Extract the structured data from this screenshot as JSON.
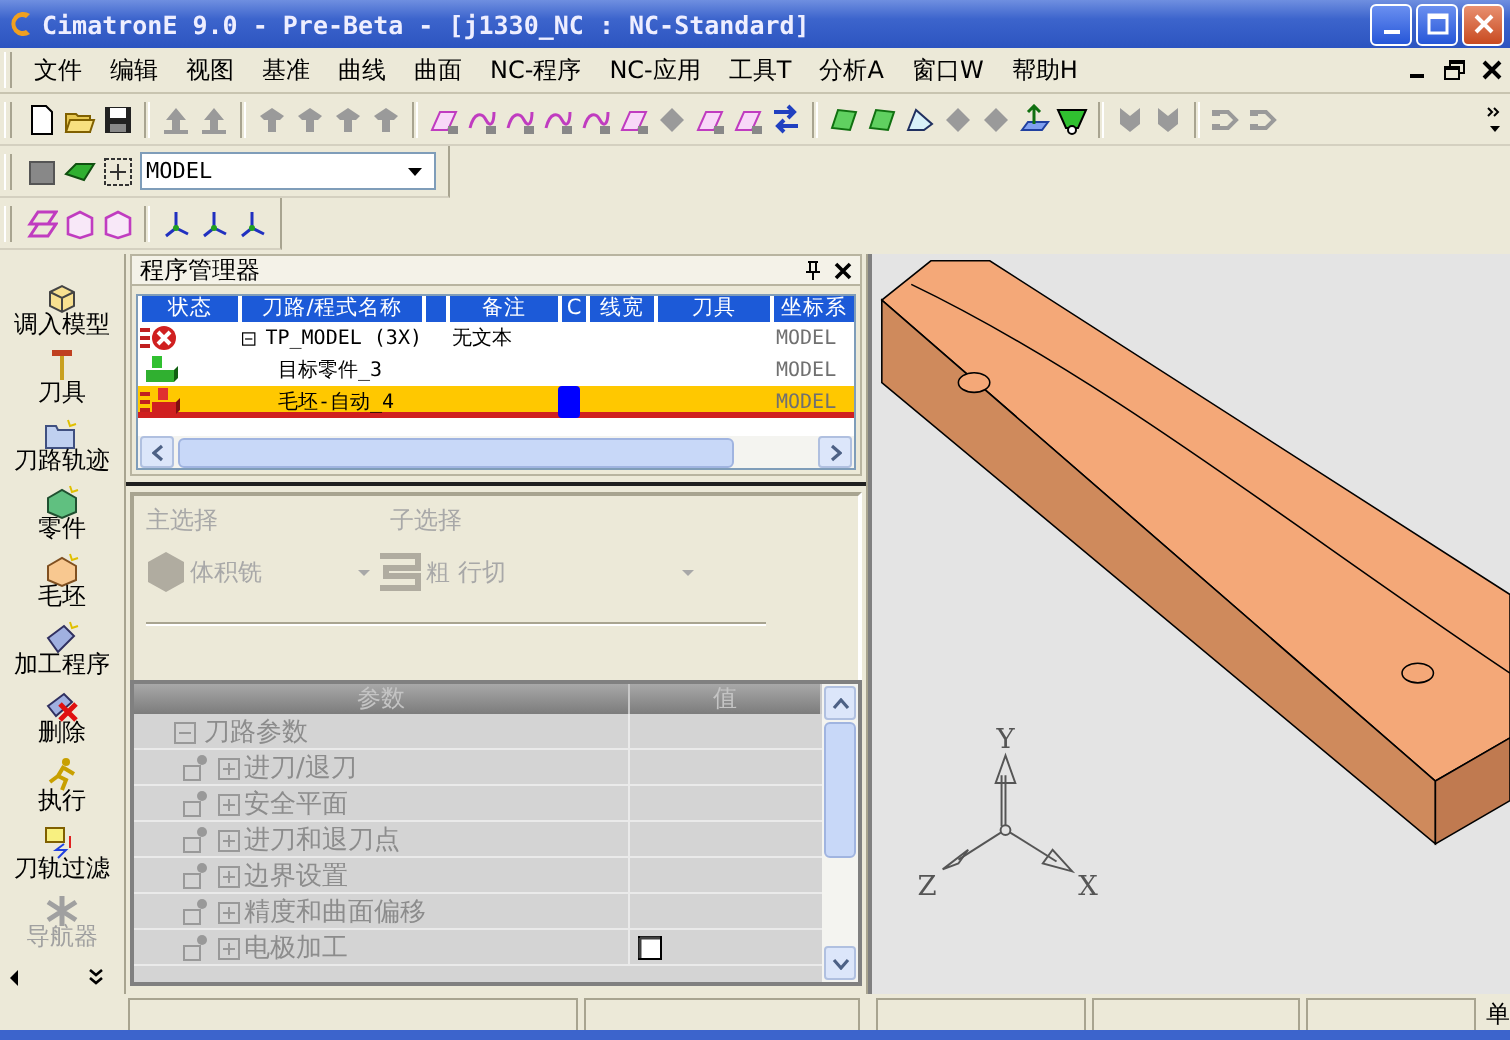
{
  "window": {
    "title": "CimatronE 9.0 - Pre-Beta - [j1330_NC : NC-Standard]"
  },
  "menu": [
    "文件",
    "编辑",
    "视图",
    "基准",
    "曲线",
    "曲面",
    "NC-程序",
    "NC-应用",
    "工具T",
    "分析A",
    "窗口W",
    "帮助H"
  ],
  "toolbar": {
    "coordinate_system": "MODEL"
  },
  "sidebar": {
    "items": [
      {
        "label": "调入模型",
        "disabled": false
      },
      {
        "label": "刀具",
        "disabled": false
      },
      {
        "label": "刀路轨迹",
        "disabled": false
      },
      {
        "label": "零件",
        "disabled": false
      },
      {
        "label": "毛坯",
        "disabled": false
      },
      {
        "label": "加工程序",
        "disabled": false
      },
      {
        "label": "删除",
        "disabled": false
      },
      {
        "label": "执行",
        "disabled": false
      },
      {
        "label": "刀轨过滤",
        "disabled": false
      },
      {
        "label": "导航器",
        "disabled": true
      }
    ]
  },
  "program_manager": {
    "title": "程序管理器",
    "columns": [
      "状态",
      "刀路/程式名称",
      "",
      "备注",
      "C",
      "线宽",
      "刀具",
      "坐标系"
    ],
    "rows": [
      {
        "kind": "error",
        "name": "TP_MODEL (3X)",
        "note": "无文本",
        "coordinate_system": "MODEL",
        "selected": false,
        "expanded": true,
        "children": [
          {
            "kind": "part",
            "name": "目标零件_3",
            "coordinate_system": "MODEL",
            "selected": false
          },
          {
            "kind": "stock",
            "name": "毛坯-自动_4",
            "coordinate_system": "MODEL",
            "selected": true,
            "color": "#0000ff"
          }
        ]
      }
    ]
  },
  "procedure": {
    "disabled": true,
    "main_label": "主选择",
    "main_value": "体积铣",
    "sub_label": "子选择",
    "sub_value": "粗 行切"
  },
  "parameters": {
    "disabled": true,
    "columns": [
      "参数",
      "值"
    ],
    "rows": [
      {
        "label": "刀路参数",
        "expanded": true,
        "children": [
          {
            "label": "进刀/退刀",
            "expanded": false
          },
          {
            "label": "安全平面",
            "expanded": false
          },
          {
            "label": "进刀和退刀点",
            "expanded": false
          },
          {
            "label": "边界设置",
            "expanded": false
          },
          {
            "label": "精度和曲面偏移",
            "expanded": false
          },
          {
            "label": "电极加工",
            "expanded": false,
            "checked": false
          }
        ]
      }
    ]
  },
  "viewport": {
    "axes": {
      "x": "X",
      "y": "Y",
      "z": "Z"
    }
  },
  "status_bar": {
    "mode": "单"
  }
}
